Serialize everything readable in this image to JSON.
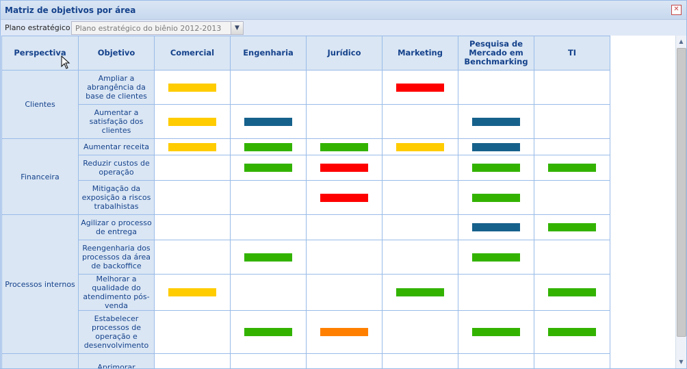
{
  "window": {
    "title": "Matriz de objetivos por área",
    "close_icon": "close-icon"
  },
  "toolbar": {
    "plan_label": "Plano estratégico",
    "plan_value": "Plano estratégico do biênio 2012-2013",
    "dropdown_icon": "chevron-down-icon"
  },
  "table": {
    "headers": [
      "Perspectiva",
      "Objetivo",
      "Comercial",
      "Engenharia",
      "Jurídico",
      "Marketing",
      "Pesquisa de Mercado em Benchmarking",
      "TI"
    ],
    "colors": {
      "yellow": "#ffcc00",
      "blue": "#16618c",
      "green": "#33b300",
      "red": "#ff0000",
      "orange": "#ff8000"
    },
    "groups": [
      {
        "perspective": "Clientes",
        "rows": [
          {
            "objective": "Ampliar a abrangência da base de clientes",
            "cells": [
              "yellow",
              "",
              "",
              "red",
              "",
              ""
            ]
          },
          {
            "objective": "Aumentar a satisfação dos clientes",
            "cells": [
              "yellow",
              "blue",
              "",
              "",
              "blue",
              ""
            ]
          }
        ]
      },
      {
        "perspective": "Financeira",
        "rows": [
          {
            "objective": "Aumentar receita",
            "cells": [
              "yellow",
              "green",
              "green",
              "yellow",
              "blue",
              ""
            ]
          },
          {
            "objective": "Reduzir custos de operação",
            "cells": [
              "",
              "green",
              "red",
              "",
              "green",
              "green"
            ]
          },
          {
            "objective": "Mitigação da exposição a riscos trabalhistas",
            "cells": [
              "",
              "",
              "red",
              "",
              "green",
              ""
            ]
          }
        ]
      },
      {
        "perspective": "Processos internos",
        "rows": [
          {
            "objective": "Agilizar o processo de entrega",
            "cells": [
              "",
              "",
              "",
              "",
              "blue",
              "green"
            ]
          },
          {
            "objective": "Reengenharia dos processos da área de backoffice",
            "cells": [
              "",
              "green",
              "",
              "",
              "green",
              ""
            ]
          },
          {
            "objective": "Melhorar a qualidade do atendimento pós-venda",
            "cells": [
              "yellow",
              "",
              "",
              "green",
              "",
              "green"
            ]
          },
          {
            "objective": "Estabelecer processos de operação e desenvolvimento",
            "cells": [
              "",
              "green",
              "orange",
              "",
              "green",
              "green"
            ]
          }
        ]
      },
      {
        "perspective": "",
        "rows": [
          {
            "objective": "Aprimorar",
            "cells": [
              "",
              "",
              "",
              "",
              "",
              ""
            ]
          }
        ]
      }
    ]
  }
}
